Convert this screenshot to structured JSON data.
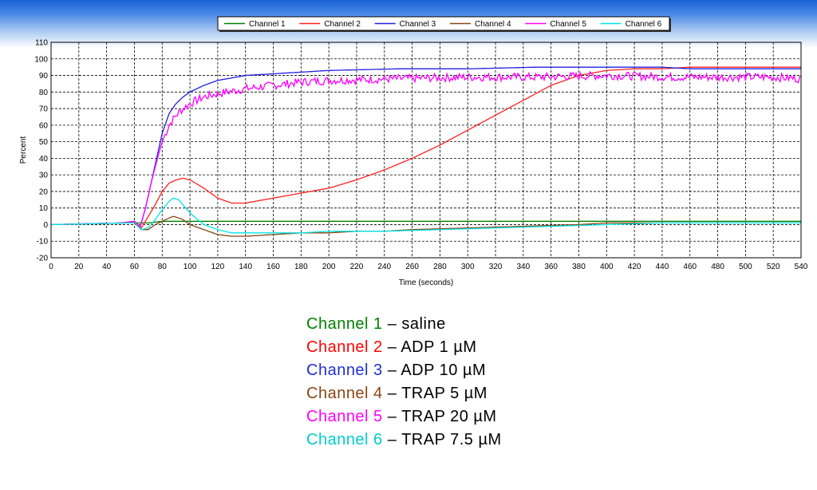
{
  "chart_data": {
    "type": "line",
    "title": "",
    "xlabel": "Time (seconds)",
    "ylabel": "Percent",
    "xlim": [
      0,
      540
    ],
    "ylim": [
      -20,
      110
    ],
    "x_ticks": [
      0,
      20,
      40,
      60,
      80,
      100,
      120,
      140,
      160,
      180,
      200,
      220,
      240,
      260,
      280,
      300,
      320,
      340,
      360,
      380,
      400,
      420,
      440,
      460,
      480,
      500,
      520,
      540
    ],
    "y_ticks": [
      -20,
      -10,
      0,
      10,
      20,
      30,
      40,
      50,
      60,
      70,
      80,
      90,
      100,
      110
    ],
    "grid": true,
    "legend_position": "top",
    "series": [
      {
        "name": "Channel 1",
        "color": "#008000",
        "noise": 0,
        "x": [
          0,
          55,
          60,
          65,
          70,
          80,
          90,
          100,
          120,
          200,
          300,
          400,
          500,
          540
        ],
        "y": [
          0,
          1,
          1,
          1,
          1,
          2,
          2,
          2,
          2,
          2,
          2,
          2,
          2,
          2
        ]
      },
      {
        "name": "Channel 2",
        "color": "#ff2020",
        "noise": 0,
        "x": [
          0,
          50,
          60,
          65,
          70,
          75,
          80,
          85,
          90,
          95,
          100,
          110,
          120,
          130,
          140,
          160,
          180,
          200,
          220,
          240,
          260,
          280,
          300,
          320,
          340,
          360,
          380,
          400,
          420,
          440,
          460,
          500,
          540
        ],
        "y": [
          0,
          1,
          2,
          -2,
          5,
          12,
          20,
          25,
          27,
          28,
          27,
          22,
          16,
          13,
          13,
          16,
          19,
          22,
          27,
          33,
          40,
          48,
          57,
          66,
          75,
          84,
          90,
          93,
          94,
          94,
          95,
          95,
          95
        ]
      },
      {
        "name": "Channel 3",
        "color": "#2020e0",
        "noise": 0,
        "x": [
          0,
          50,
          60,
          64,
          68,
          72,
          76,
          80,
          85,
          90,
          95,
          100,
          110,
          120,
          140,
          160,
          180,
          200,
          250,
          300,
          350,
          400,
          440,
          460,
          480,
          500,
          540
        ],
        "y": [
          0,
          1,
          2,
          -2,
          10,
          25,
          40,
          55,
          67,
          73,
          77,
          80,
          84,
          87,
          90,
          91,
          92,
          93,
          94,
          94,
          95,
          95,
          95,
          94,
          94,
          94,
          94
        ]
      },
      {
        "name": "Channel 4",
        "color": "#8b4513",
        "noise": 0,
        "x": [
          0,
          55,
          60,
          65,
          70,
          75,
          80,
          85,
          88,
          92,
          95,
          100,
          110,
          120,
          130,
          140,
          160,
          180,
          200,
          220,
          240,
          260,
          300,
          340,
          380,
          400,
          440,
          480,
          520,
          540
        ],
        "y": [
          0,
          1,
          1,
          -3,
          -3,
          0,
          2,
          4,
          5,
          4,
          3,
          0,
          -3,
          -6,
          -7,
          -7,
          -6,
          -5,
          -5,
          -4,
          -4,
          -3,
          -2,
          -1,
          0,
          1,
          1,
          1,
          1,
          1
        ]
      },
      {
        "name": "Channel 5",
        "color": "#ff00ff",
        "noise": 2.5,
        "x": [
          0,
          50,
          60,
          64,
          68,
          72,
          76,
          80,
          85,
          90,
          95,
          100,
          110,
          120,
          140,
          160,
          180,
          200,
          250,
          300,
          350,
          400,
          450,
          500,
          520,
          540
        ],
        "y": [
          0,
          1,
          2,
          -2,
          10,
          25,
          38,
          50,
          60,
          66,
          70,
          73,
          77,
          79,
          82,
          84,
          86,
          87,
          88,
          89,
          89,
          90,
          89,
          89,
          89,
          88
        ]
      },
      {
        "name": "Channel 6",
        "color": "#00e5e5",
        "noise": 0,
        "x": [
          0,
          55,
          60,
          65,
          70,
          75,
          80,
          85,
          88,
          92,
          95,
          100,
          110,
          120,
          130,
          140,
          160,
          180,
          200,
          240,
          280,
          320,
          360,
          400,
          440,
          480,
          540
        ],
        "y": [
          0,
          1,
          1,
          -3,
          -2,
          3,
          9,
          14,
          16,
          15,
          12,
          7,
          0,
          -3,
          -5,
          -5,
          -5,
          -5,
          -4,
          -4,
          -3,
          -2,
          -1,
          0,
          1,
          1,
          1
        ]
      }
    ]
  },
  "key": [
    {
      "channel": "Channel 1",
      "color": "#008000",
      "desc": "– saline"
    },
    {
      "channel": "Channel 2",
      "color": "#ff0000",
      "desc": "– ADP 1 µM"
    },
    {
      "channel": "Channel 3",
      "color": "#2030d0",
      "desc": "– ADP 10 µM"
    },
    {
      "channel": "Channel 4",
      "color": "#8b4513",
      "desc": "– TRAP 5 µM"
    },
    {
      "channel": "Channel 5",
      "color": "#ff00ff",
      "desc": "– TRAP 20 µM"
    },
    {
      "channel": "Channel 6",
      "color": "#00cccc",
      "desc": "– TRAP 7.5 µM"
    }
  ]
}
